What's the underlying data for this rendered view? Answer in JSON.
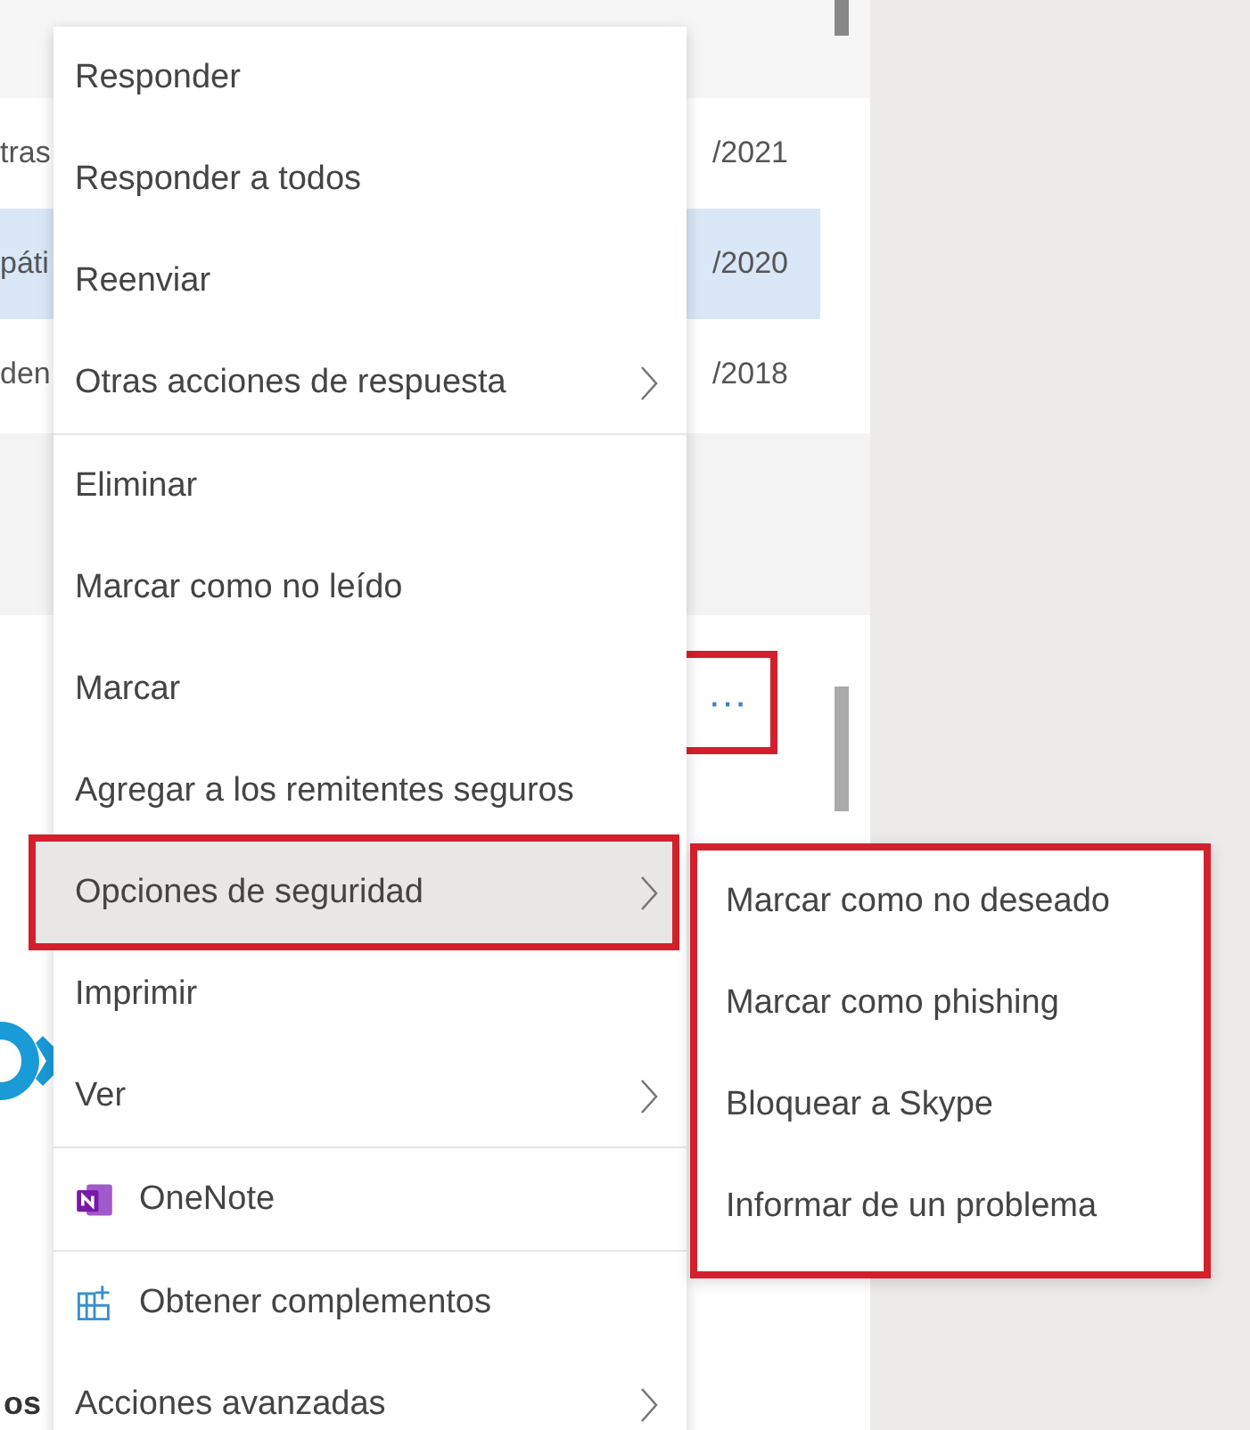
{
  "message_list": {
    "rows": [
      {
        "sender": "tras",
        "date": "/2021",
        "selected": false
      },
      {
        "sender": "páti",
        "date": "/2020",
        "selected": true
      },
      {
        "sender": "den",
        "date": "/2018",
        "selected": false
      }
    ]
  },
  "reading_pane": {
    "more_button": {
      "label": "···",
      "highlighted": true
    },
    "footer_text": "os"
  },
  "context_menu": {
    "groups": [
      [
        {
          "label": "Responder",
          "kind": "plain",
          "has_submenu": false,
          "selected": false,
          "highlighted": false
        },
        {
          "label": "Responder a todos",
          "kind": "plain",
          "has_submenu": false,
          "selected": false,
          "highlighted": false
        },
        {
          "label": "Reenviar",
          "kind": "plain",
          "has_submenu": false,
          "selected": false,
          "highlighted": false
        },
        {
          "label": "Otras acciones de respuesta",
          "kind": "plain",
          "has_submenu": true,
          "selected": false,
          "highlighted": false
        }
      ],
      [
        {
          "label": "Eliminar",
          "kind": "plain",
          "has_submenu": false,
          "selected": false,
          "highlighted": false
        },
        {
          "label": "Marcar como no leído",
          "kind": "plain",
          "has_submenu": false,
          "selected": false,
          "highlighted": false
        },
        {
          "label": "Marcar",
          "kind": "plain",
          "has_submenu": false,
          "selected": false,
          "highlighted": false
        },
        {
          "label": "Agregar a los remitentes seguros",
          "kind": "plain",
          "has_submenu": false,
          "selected": false,
          "highlighted": false
        },
        {
          "label": "Opciones de seguridad",
          "kind": "plain",
          "has_submenu": true,
          "selected": true,
          "highlighted": true
        },
        {
          "label": "Imprimir",
          "kind": "plain",
          "has_submenu": false,
          "selected": false,
          "highlighted": false
        },
        {
          "label": "Ver",
          "kind": "plain",
          "has_submenu": true,
          "selected": false,
          "highlighted": false
        }
      ],
      [
        {
          "label": "OneNote",
          "kind": "onenote",
          "has_submenu": false,
          "selected": false,
          "highlighted": false
        }
      ],
      [
        {
          "label": "Obtener complementos",
          "kind": "addins",
          "has_submenu": false,
          "selected": false,
          "highlighted": false
        },
        {
          "label": "Acciones avanzadas",
          "kind": "plain",
          "has_submenu": true,
          "selected": false,
          "highlighted": false
        }
      ]
    ]
  },
  "submenu": {
    "highlighted": true,
    "items": [
      "Marcar como no deseado",
      "Marcar como phishing",
      "Bloquear a Skype",
      "Informar de un problema"
    ]
  }
}
